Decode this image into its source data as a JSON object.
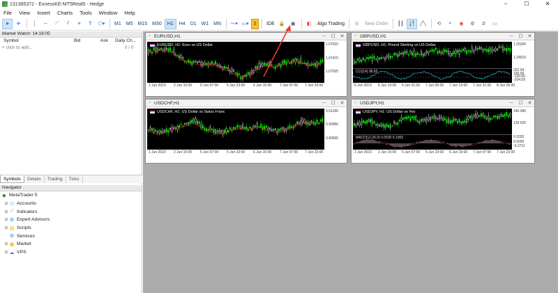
{
  "window": {
    "title": "131385372 - ExnessKE-MT5Real9 - Hedge",
    "buttons": [
      "–",
      "☐",
      "✕"
    ]
  },
  "menu": [
    "File",
    "View",
    "Insert",
    "Charts",
    "Tools",
    "Window",
    "Help"
  ],
  "toolbar": {
    "timeframes": [
      "M1",
      "M5",
      "M15",
      "M30",
      "H1",
      "H4",
      "D1",
      "W1",
      "MN"
    ],
    "selected_timeframe": "H1",
    "ide": "IDE",
    "algo_trading": "Algo Trading",
    "new_order": "New Order"
  },
  "market_watch": {
    "title": "Market Watch: 14:18:05",
    "columns": [
      "Symbol",
      "Bid",
      "Ask",
      "Daily Ch..."
    ],
    "add_row": "click to add...",
    "count": "0 / 0",
    "tabs": [
      "Symbols",
      "Details",
      "Trading",
      "Ticks"
    ],
    "active_tab": "Symbols"
  },
  "navigator": {
    "title": "Navigator",
    "root": "MetaTrader 5",
    "items": [
      "Accounts",
      "Indicators",
      "Expert Advisors",
      "Scripts",
      "Services",
      "Market",
      "VPS"
    ]
  },
  "charts": [
    {
      "window_title": "EURUSD,H1",
      "label": "EURUSD, H1:  Euro vs US Dollar",
      "prices": [
        "1.07915",
        "1.07470",
        "1.07025"
      ],
      "times": [
        "1 Jun 2023",
        "2 Jun 15:00",
        "5 Jun 07:00",
        "5 Jun 23:00",
        "6 Jun 15:00",
        "7 Jun 07:00",
        "7 Jun 23:00"
      ]
    },
    {
      "window_title": "GBPUSD,H1",
      "label": "GBPUSD, H1:  Pound Sterling vs US Dollar",
      "prices": [
        "1.25265",
        "1.24515"
      ],
      "sub_label": "CCI(14) 98.63",
      "sub_prices": [
        "252.04",
        "100.00",
        "-100.00",
        "-204.59"
      ],
      "times": [
        "6 Jun 2023",
        "6 Jun 13:00",
        "6 Jun 21:00",
        "7 Jun 05:00",
        "7 Jun 13:00",
        "7 Jun 21:00",
        "8 Jun 05:00"
      ]
    },
    {
      "window_title": "USDCHF,H1",
      "label": "USDCHF, H1:  US Dollar vs Swiss Franc",
      "prices": [
        "0.91295",
        "0.90950",
        "0.90605"
      ],
      "times": [
        "1 Jun 2023",
        "2 Jun 15:00",
        "5 Jun 07:00",
        "5 Jun 23:00",
        "6 Jun 15:00",
        "7 Jun 07:00",
        "7 Jun 23:00"
      ]
    },
    {
      "window_title": "USDJPY,H1",
      "label": "USDJPY, H1:  US Dollar vs Yen",
      "prices": [
        "140.090",
        "139.625"
      ],
      "sub_label": "MACD(12,26,9) 0.0530 0.1065",
      "sub_prices": [
        "0.3293",
        "0.0000",
        "-0.2711"
      ],
      "times": [
        "1 Jun 2023",
        "2 Jun 15:00",
        "5 Jun 07:00",
        "5 Jun 23:00",
        "6 Jun 15:00",
        "7 Jun 07:00",
        "7 Jun 23:00"
      ]
    }
  ],
  "colors": {
    "bull": "#00e000",
    "bear": "#ffffff",
    "ma": "#e02020",
    "arrow": "#e53935",
    "accent": "#1565c0"
  }
}
